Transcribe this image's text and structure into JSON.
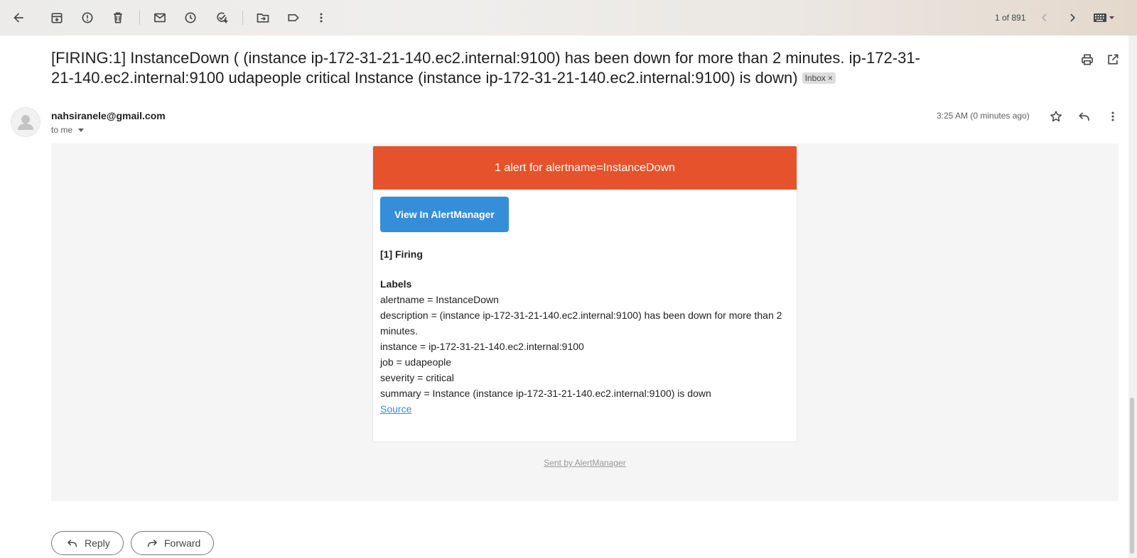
{
  "toolbar": {
    "pager_text": "1 of 891",
    "icons": [
      "back-arrow-icon",
      "archive-icon",
      "report-spam-icon",
      "delete-icon",
      "mark-unread-icon",
      "snooze-icon",
      "add-task-icon",
      "move-to-icon",
      "label-icon",
      "more-vert-icon",
      "newer-chevron-icon",
      "older-chevron-icon",
      "keyboard-icon"
    ]
  },
  "email": {
    "subject": "[FIRING:1] InstanceDown ( (instance ip-172-31-21-140.ec2.internal:9100) has been down for more than 2 minutes. ip-172-31-21-140.ec2.internal:9100 udapeople critical Instance (instance ip-172-31-21-140.ec2.internal:9100) is down)",
    "label_chip": "Inbox",
    "sender": "nahsiranele@gmail.com",
    "recipient": "to me",
    "timestamp": "3:25 AM (0 minutes ago)"
  },
  "alert": {
    "header": "1 alert for alertname=InstanceDown",
    "button_label": "View In AlertManager",
    "firing_heading": "[1] Firing",
    "labels_heading": "Labels",
    "lines": [
      "alertname = InstanceDown",
      "description = (instance ip-172-31-21-140.ec2.internal:9100) has been down for more than 2 minutes.",
      "instance = ip-172-31-21-140.ec2.internal:9100",
      "job = udapeople",
      "severity = critical",
      "summary = Instance (instance ip-172-31-21-140.ec2.internal:9100) is down"
    ],
    "source_link": "Source",
    "footer": "Sent by AlertManager"
  },
  "actions": {
    "reply_label": "Reply",
    "forward_label": "Forward"
  },
  "colors": {
    "alert_header": "#e6522c",
    "button_blue": "#348eda"
  }
}
